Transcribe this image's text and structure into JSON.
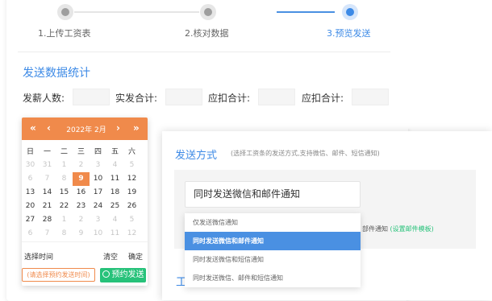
{
  "steps": [
    {
      "label": "1.上传工资表"
    },
    {
      "label": "2.核对数据"
    },
    {
      "label": "3.预览发送"
    }
  ],
  "section_title": "发送数据统计",
  "stats": [
    {
      "label": "发薪人数:",
      "value": ""
    },
    {
      "label": "实发合计:",
      "value": ""
    },
    {
      "label": "应扣合计:",
      "value": ""
    },
    {
      "label": "应扣合计:",
      "value": ""
    }
  ],
  "calendar": {
    "nav_prev_year": "«",
    "nav_prev_month": "‹",
    "title": "2022年 2月",
    "nav_next_month": "›",
    "nav_next_year": "»",
    "weekdays": [
      "日",
      "一",
      "二",
      "三",
      "四",
      "五",
      "六"
    ],
    "rows": [
      [
        "30",
        "31",
        "1",
        "2",
        "3",
        "4",
        "5"
      ],
      [
        "6",
        "7",
        "8",
        "9",
        "10",
        "11",
        "12"
      ],
      [
        "13",
        "14",
        "15",
        "16",
        "17",
        "18",
        "19"
      ],
      [
        "20",
        "21",
        "22",
        "23",
        "24",
        "25",
        "26"
      ],
      [
        "27",
        "28",
        "1",
        "2",
        "3",
        "4",
        "5"
      ],
      [
        "6",
        "7",
        "8",
        "9",
        "10",
        "11",
        "12"
      ]
    ],
    "dim_cells": [
      "0-0",
      "0-1",
      "0-2",
      "0-3",
      "0-4",
      "0-5",
      "0-6",
      "1-0",
      "1-1",
      "1-2",
      "4-2",
      "4-3",
      "4-4",
      "4-5",
      "4-6",
      "5-0",
      "5-1",
      "5-2",
      "5-3",
      "5-4",
      "5-5",
      "5-6"
    ],
    "selected_cell": "1-3",
    "footer_label": "选择时间",
    "clear_label": "清空",
    "confirm_label": "确定",
    "hint_button": "(请选择预约发送时间)",
    "schedule_button": "预约发送"
  },
  "send_method": {
    "title": "发送方式",
    "subtitle": "(选择工资条的发送方式,支持微信、邮件、短信通知)",
    "selected_value": "同时发送微信和邮件通知",
    "email_tail_text": "部件通知",
    "email_template_link": "(设置邮件模板)",
    "options": [
      "仅发送微信通知",
      "同时发送微信和邮件通知",
      "同时发送微信和短信通知",
      "同时发送微信、邮件和短信通知"
    ],
    "selected_index": 1,
    "peek_text": "工"
  },
  "colors": {
    "accent_blue": "#3d8ae6",
    "calendar_orange": "#f08a4b",
    "green": "#27c27a"
  }
}
